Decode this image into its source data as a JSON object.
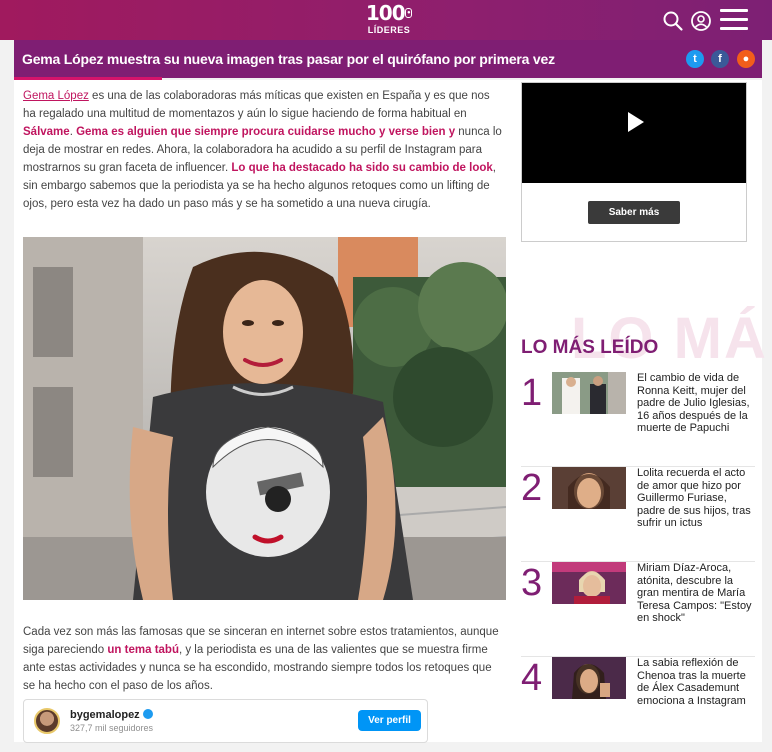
{
  "header": {
    "logo_number": "100",
    "logo_text": "LÍDERES"
  },
  "article": {
    "title": "Gema López muestra su nueva imagen tras pasar por el quirófano por primera vez",
    "p1": [
      {
        "t": "Gema López",
        "s": "link"
      },
      {
        "t": " es una de las colaboradoras más míticas que existen en España y es que nos ha regalado una multitud de momentazos y aún lo sigue haciendo de forma habitual en ",
        "s": ""
      },
      {
        "t": "Sálvame",
        "s": "b"
      },
      {
        "t": ". ",
        "s": ""
      },
      {
        "t": "Gema es alguien que siempre procura cuidarse mucho y verse bien y",
        "s": "b"
      },
      {
        "t": " nunca lo deja de mostrar en redes. Ahora, la colaboradora ha acudido a su perfil de Instagram para mostrarnos su gran faceta de influencer. ",
        "s": ""
      },
      {
        "t": "Lo que ha destacado ha sido su cambio de look",
        "s": "b"
      },
      {
        "t": ", sin embargo sabemos que la periodista ya se ha hecho algunos retoques como un lifting de ojos, pero esta vez ha dado un paso más y se ha sometido a una nueva cirugía.",
        "s": ""
      }
    ],
    "p2": [
      {
        "t": "Cada vez son más las famosas que se sinceran en internet sobre estos tratamientos, aunque siga pareciendo ",
        "s": ""
      },
      {
        "t": "un tema tabú",
        "s": "b"
      },
      {
        "t": ", y la periodista es una de las valientes que se muestra firme ante estas actividades y nunca se ha escondido, mostrando siempre todos los retoques que se ha hecho con el paso de los años.",
        "s": ""
      }
    ],
    "instagram": {
      "username": "bygemalopez",
      "followers": "327,7 mil seguidores",
      "button": "Ver perfil"
    }
  },
  "sidebar": {
    "video_button": "Saber más",
    "most_read_bg": "LO MÁ",
    "most_read_title": "LO MÁS LEÍDO",
    "items": [
      {
        "num": "1",
        "text": "El cambio de vida de Ronna Keitt, mujer del padre de Julio Iglesias, 16 años después de la muerte de Papuchi"
      },
      {
        "num": "2",
        "text": "Lolita recuerda el acto de amor que hizo por Guillermo Furiase, padre de sus hijos, tras sufrir un ictus"
      },
      {
        "num": "3",
        "text": "Miriam Díaz-Aroca, atónita, descubre la gran mentira de María Teresa Campos: \"Estoy en shock\""
      },
      {
        "num": "4",
        "text": "La sabia reflexión de Chenoa tras la muerte de Álex Casademunt emociona a Instagram"
      }
    ]
  }
}
